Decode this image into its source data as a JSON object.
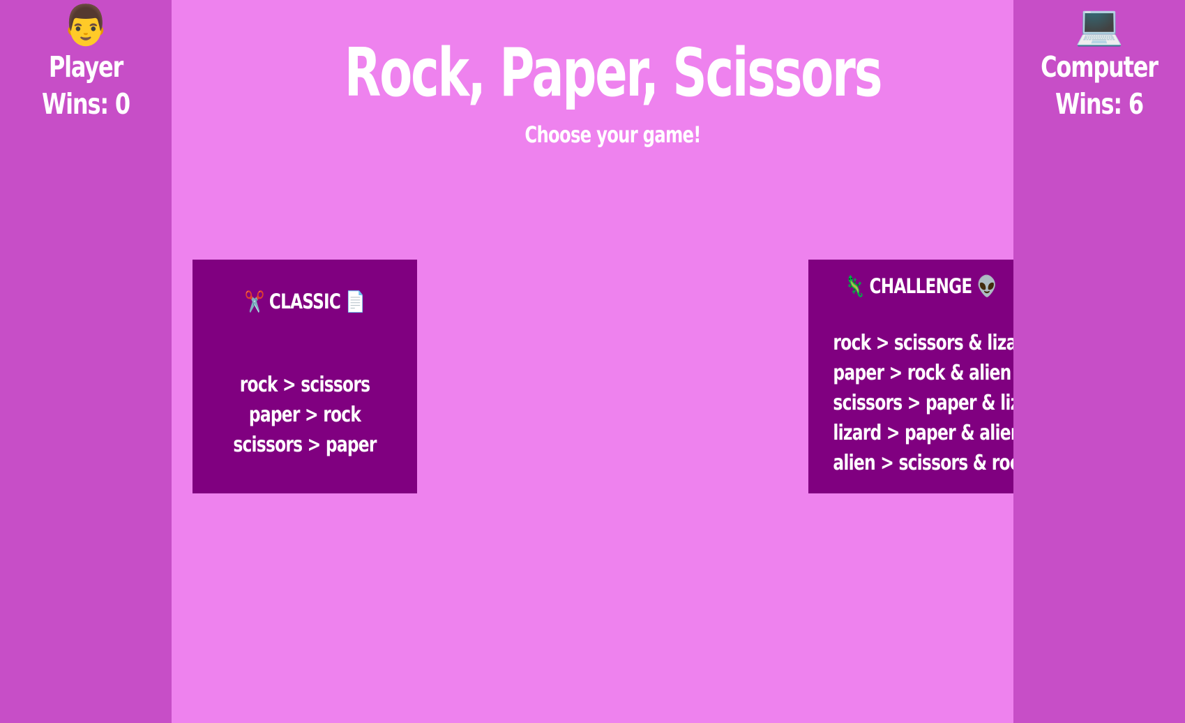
{
  "player": {
    "avatar": "👨",
    "name": "Player",
    "wins_label": "Wins: 0",
    "wins": 0
  },
  "computer": {
    "avatar": "💻",
    "name": "Computer",
    "wins_label": "Wins: 6",
    "wins": 6
  },
  "header": {
    "title": "Rock, Paper, Scissors",
    "subtitle": "Choose your game!"
  },
  "games": {
    "classic": {
      "title": "✂️ CLASSIC 📄",
      "rules": [
        "rock > scissors",
        "paper > rock",
        "scissors > paper"
      ]
    },
    "challenge": {
      "title": "🦎 CHALLENGE 👽",
      "rules": [
        "rock > scissors & lizard",
        "paper > rock & alien",
        "scissors > paper & lizard",
        "lizard > paper & alien",
        "alien > scissors & rock"
      ]
    }
  },
  "colors": {
    "background": "#ee82ee",
    "sidebar": "#c74ec7",
    "card": "#800080",
    "text": "#ffffff"
  }
}
